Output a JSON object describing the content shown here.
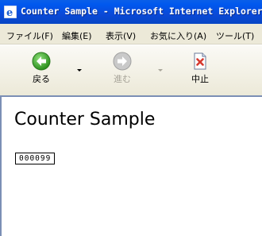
{
  "window": {
    "title": "Counter Sample - Microsoft Internet Explorer"
  },
  "menu": {
    "items": [
      {
        "label": "ファイル(F)"
      },
      {
        "label": "編集(E)"
      },
      {
        "label": "表示(V)"
      },
      {
        "label": "お気に入り(A)"
      },
      {
        "label": "ツール(T)"
      }
    ]
  },
  "toolbar": {
    "back_label": "戻る",
    "forward_label": "進む",
    "stop_label": "中止",
    "icons": {
      "back": "back-arrow-icon",
      "forward": "forward-arrow-icon",
      "stop": "stop-page-icon"
    },
    "colors": {
      "back": "#3aa12a",
      "forward": "#b4b4b4",
      "stop": "#d63a2f"
    }
  },
  "page": {
    "heading": "Counter Sample",
    "counter": "000099"
  }
}
